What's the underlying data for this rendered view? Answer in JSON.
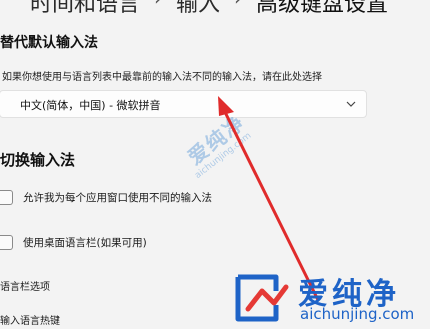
{
  "breadcrumb": {
    "items": [
      "时间和语言",
      "输入",
      "高级键盘设置"
    ],
    "separator": "›"
  },
  "replace_default": {
    "title": "替代默认输入法",
    "description": "如果你想使用与语言列表中最靠前的输入法不同的输入法，请在此处选择",
    "selected_value": "中文(简体，中国) - 微软拼音"
  },
  "switch_input": {
    "title": "切换输入法",
    "options": [
      {
        "label": "允许我为每个应用窗口使用不同的输入法",
        "checked": false
      },
      {
        "label": "使用桌面语言栏(如果可用)",
        "checked": false
      }
    ],
    "links": [
      "语言栏选项",
      "输入语言热键"
    ]
  },
  "watermark": {
    "center_name": "爱纯净",
    "center_url": "aichunjing.com",
    "logo_name": "爱纯净",
    "logo_url": "aichunjing.com"
  },
  "colors": {
    "page_bg": "#f3f3f3",
    "annotation_arrow": "#e02b2b",
    "brand_blue": "#1e63c7"
  },
  "icons": {
    "dropdown": "chevron-down-icon",
    "logo": "aichunjing-logo-icon"
  }
}
